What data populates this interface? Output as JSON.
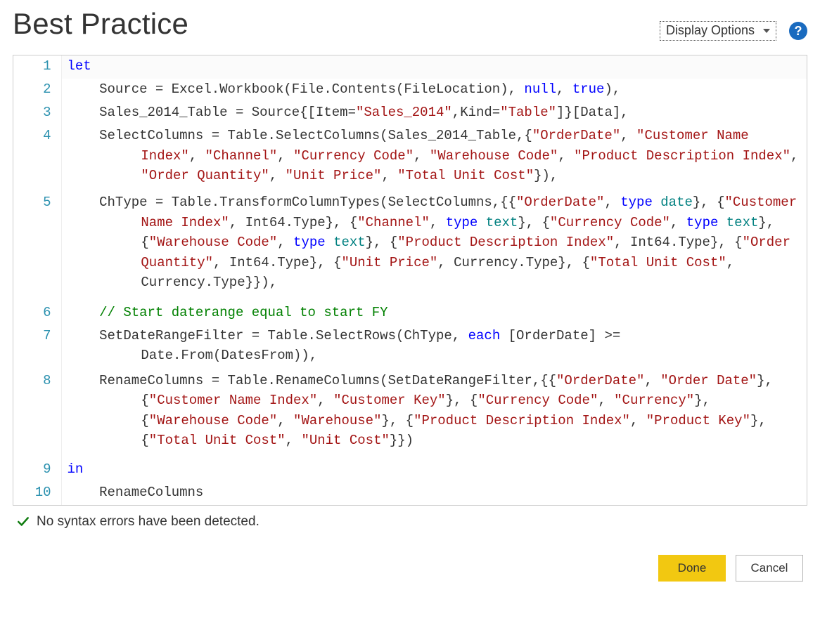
{
  "header": {
    "title": "Best Practice",
    "display_options_label": "Display Options",
    "help_glyph": "?"
  },
  "colors": {
    "accent_yellow": "#f2c811",
    "help_blue": "#1a6bbf",
    "line_number": "#2b91af"
  },
  "code_lines": [
    {
      "n": 1,
      "tokens": [
        [
          "kw",
          "let"
        ]
      ]
    },
    {
      "n": 2,
      "tokens": [
        [
          "",
          "    Source = Excel.Workbook(File.Contents(FileLocation), "
        ],
        [
          "kw",
          "null"
        ],
        [
          "",
          ", "
        ],
        [
          "kw",
          "true"
        ],
        [
          "",
          "),"
        ]
      ]
    },
    {
      "n": 3,
      "tokens": [
        [
          "",
          "    Sales_2014_Table = Source{[Item="
        ],
        [
          "str",
          "\"Sales_2014\""
        ],
        [
          "",
          ",Kind="
        ],
        [
          "str",
          "\"Table\""
        ],
        [
          "",
          "]}[Data],"
        ]
      ]
    },
    {
      "n": 4,
      "tokens": [
        [
          "",
          "    SelectColumns = Table.SelectColumns(Sales_2014_Table,{"
        ],
        [
          "str",
          "\"OrderDate\""
        ],
        [
          "",
          ", "
        ],
        [
          "str",
          "\"Customer Name Index\""
        ],
        [
          "",
          ", "
        ],
        [
          "str",
          "\"Channel\""
        ],
        [
          "",
          ", "
        ],
        [
          "str",
          "\"Currency Code\""
        ],
        [
          "",
          ", "
        ],
        [
          "str",
          "\"Warehouse Code\""
        ],
        [
          "",
          ", "
        ],
        [
          "str",
          "\"Product Description Index\""
        ],
        [
          "",
          ", "
        ],
        [
          "str",
          "\"Order Quantity\""
        ],
        [
          "",
          ", "
        ],
        [
          "str",
          "\"Unit Price\""
        ],
        [
          "",
          ", "
        ],
        [
          "str",
          "\"Total Unit Cost\""
        ],
        [
          "",
          "}),"
        ]
      ],
      "wrap_indent": true
    },
    {
      "n": 5,
      "tokens": [
        [
          "",
          "    ChType = Table.TransformColumnTypes(SelectColumns,{{"
        ],
        [
          "str",
          "\"OrderDate\""
        ],
        [
          "",
          ", "
        ],
        [
          "kw",
          "type"
        ],
        [
          "",
          " "
        ],
        [
          "typ",
          "date"
        ],
        [
          "",
          "}, {"
        ],
        [
          "str",
          "\"Customer Name Index\""
        ],
        [
          "",
          ", Int64.Type}, {"
        ],
        [
          "str",
          "\"Channel\""
        ],
        [
          "",
          ", "
        ],
        [
          "kw",
          "type"
        ],
        [
          "",
          " "
        ],
        [
          "typ",
          "text"
        ],
        [
          "",
          "}, {"
        ],
        [
          "str",
          "\"Currency Code\""
        ],
        [
          "",
          ", "
        ],
        [
          "kw",
          "type"
        ],
        [
          "",
          " "
        ],
        [
          "typ",
          "text"
        ],
        [
          "",
          "}, {"
        ],
        [
          "str",
          "\"Warehouse Code\""
        ],
        [
          "",
          ", "
        ],
        [
          "kw",
          "type"
        ],
        [
          "",
          " "
        ],
        [
          "typ",
          "text"
        ],
        [
          "",
          "}, {"
        ],
        [
          "str",
          "\"Product Description Index\""
        ],
        [
          "",
          ", Int64.Type}, {"
        ],
        [
          "str",
          "\"Order Quantity\""
        ],
        [
          "",
          ", Int64.Type}, {"
        ],
        [
          "str",
          "\"Unit Price\""
        ],
        [
          "",
          ", Currency.Type}, {"
        ],
        [
          "str",
          "\"Total Unit Cost\""
        ],
        [
          "",
          ", Currency.Type}}),"
        ]
      ],
      "wrap_indent": true
    },
    {
      "n": 6,
      "tokens": [
        [
          "",
          "    "
        ],
        [
          "com",
          "// Start daterange equal to start FY"
        ]
      ]
    },
    {
      "n": 7,
      "tokens": [
        [
          "",
          "    SetDateRangeFilter = Table.SelectRows(ChType, "
        ],
        [
          "kw",
          "each"
        ],
        [
          "",
          " [OrderDate] >= Date.From(DatesFrom)),"
        ]
      ],
      "wrap_indent": true
    },
    {
      "n": 8,
      "tokens": [
        [
          "",
          "    RenameColumns = Table.RenameColumns(SetDateRangeFilter,{{"
        ],
        [
          "str",
          "\"OrderDate\""
        ],
        [
          "",
          ", "
        ],
        [
          "str",
          "\"Order Date\""
        ],
        [
          "",
          "}, {"
        ],
        [
          "str",
          "\"Customer Name Index\""
        ],
        [
          "",
          ", "
        ],
        [
          "str",
          "\"Customer Key\""
        ],
        [
          "",
          "}, {"
        ],
        [
          "str",
          "\"Currency Code\""
        ],
        [
          "",
          ", "
        ],
        [
          "str",
          "\"Currency\""
        ],
        [
          "",
          "}, {"
        ],
        [
          "str",
          "\"Warehouse Code\""
        ],
        [
          "",
          ", "
        ],
        [
          "str",
          "\"Warehouse\""
        ],
        [
          "",
          "}, {"
        ],
        [
          "str",
          "\"Product Description Index\""
        ],
        [
          "",
          ", "
        ],
        [
          "str",
          "\"Product Key\""
        ],
        [
          "",
          "}, {"
        ],
        [
          "str",
          "\"Total Unit Cost\""
        ],
        [
          "",
          ", "
        ],
        [
          "str",
          "\"Unit Cost\""
        ],
        [
          "",
          "}})"
        ]
      ],
      "wrap_indent": true
    },
    {
      "n": 9,
      "tokens": [
        [
          "kw",
          "in"
        ]
      ]
    },
    {
      "n": 10,
      "tokens": [
        [
          "",
          "    RenameColumns"
        ]
      ]
    }
  ],
  "status": {
    "message": "No syntax errors have been detected."
  },
  "buttons": {
    "done": "Done",
    "cancel": "Cancel"
  }
}
